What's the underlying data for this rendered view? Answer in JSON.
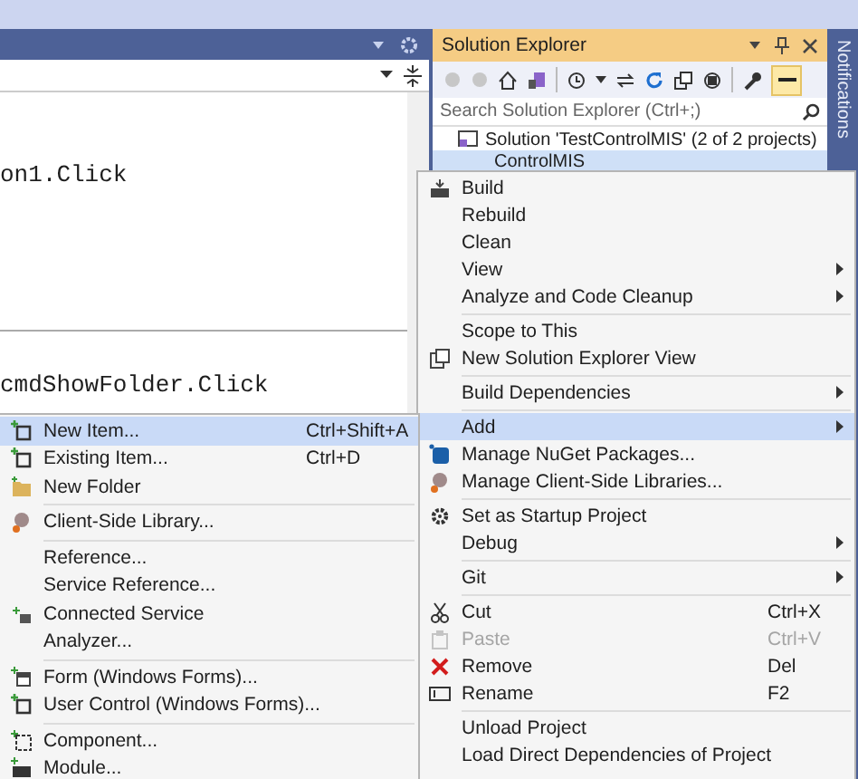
{
  "editor": {
    "code_lines": [
      {
        "text": "on1.Click"
      },
      {
        "text": "cmdShowFolder.Click"
      }
    ]
  },
  "solution_explorer": {
    "title": "Solution Explorer",
    "search": {
      "placeholder": "Search Solution Explorer (Ctrl+;)"
    },
    "tree": [
      {
        "label": "Solution 'TestControlMIS' (2 of 2 projects)",
        "selected": false,
        "children": [
          {
            "label": "ControlMIS",
            "selected": true
          }
        ]
      }
    ]
  },
  "notifications": {
    "label": "Notifications"
  },
  "context_menu": {
    "groups": [
      [
        {
          "label": "Build",
          "selected": false,
          "disabled": false,
          "submenu": false
        },
        {
          "label": "Rebuild",
          "selected": false,
          "disabled": false,
          "submenu": false
        },
        {
          "label": "Clean",
          "selected": false,
          "disabled": false,
          "submenu": false
        },
        {
          "label": "View",
          "selected": false,
          "disabled": false,
          "submenu": true
        },
        {
          "label": "Analyze and Code Cleanup",
          "selected": false,
          "disabled": false,
          "submenu": true
        }
      ],
      [
        {
          "label": "Scope to This",
          "selected": false,
          "disabled": false,
          "submenu": false
        },
        {
          "label": "New Solution Explorer View",
          "selected": false,
          "disabled": false,
          "submenu": false
        }
      ],
      [
        {
          "label": "Build Dependencies",
          "selected": false,
          "disabled": false,
          "submenu": true
        }
      ],
      [
        {
          "label": "Add",
          "selected": true,
          "disabled": false,
          "submenu": true
        },
        {
          "label": "Manage NuGet Packages...",
          "selected": false,
          "disabled": false,
          "submenu": false
        },
        {
          "label": "Manage Client-Side Libraries...",
          "selected": false,
          "disabled": false,
          "submenu": false
        }
      ],
      [
        {
          "label": "Set as Startup Project",
          "selected": false,
          "disabled": false,
          "submenu": false
        },
        {
          "label": "Debug",
          "selected": false,
          "disabled": false,
          "submenu": true
        }
      ],
      [
        {
          "label": "Git",
          "selected": false,
          "disabled": false,
          "submenu": true
        }
      ],
      [
        {
          "label": "Cut",
          "shortcut": "Ctrl+X",
          "selected": false,
          "disabled": false,
          "submenu": false
        },
        {
          "label": "Paste",
          "shortcut": "Ctrl+V",
          "selected": false,
          "disabled": true,
          "submenu": false
        },
        {
          "label": "Remove",
          "shortcut": "Del",
          "selected": false,
          "disabled": false,
          "submenu": false
        },
        {
          "label": "Rename",
          "shortcut": "F2",
          "selected": false,
          "disabled": false,
          "submenu": false
        }
      ],
      [
        {
          "label": "Unload Project",
          "selected": false,
          "disabled": false,
          "submenu": false
        },
        {
          "label": "Load Direct Dependencies of Project",
          "selected": false,
          "disabled": false,
          "submenu": false
        }
      ]
    ]
  },
  "add_submenu": {
    "groups": [
      [
        {
          "label": "New Item...",
          "shortcut": "Ctrl+Shift+A",
          "selected": true
        },
        {
          "label": "Existing Item...",
          "shortcut": "Ctrl+D",
          "selected": false
        },
        {
          "label": "New Folder",
          "selected": false
        }
      ],
      [
        {
          "label": "Client-Side Library...",
          "selected": false
        }
      ],
      [
        {
          "label": "Reference...",
          "selected": false
        },
        {
          "label": "Service Reference...",
          "selected": false
        },
        {
          "label": "Connected Service",
          "selected": false
        },
        {
          "label": "Analyzer...",
          "selected": false
        }
      ],
      [
        {
          "label": "Form (Windows Forms)...",
          "selected": false
        },
        {
          "label": "User Control (Windows Forms)...",
          "selected": false
        }
      ],
      [
        {
          "label": "Component...",
          "selected": false
        },
        {
          "label": "Module...",
          "selected": false
        }
      ]
    ]
  }
}
